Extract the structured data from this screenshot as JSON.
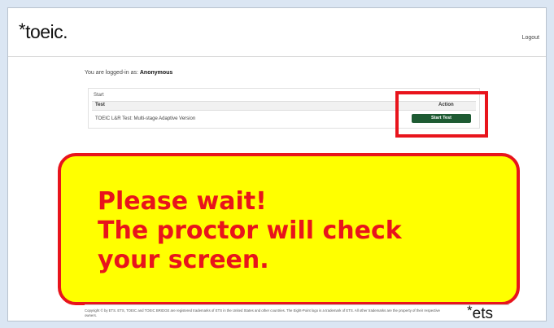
{
  "header": {
    "logo_star": "*",
    "logo_text": "toeic",
    "logo_dot": ".",
    "logout_label": "Logout"
  },
  "session": {
    "logged_in_prefix": "You are logged-in as:",
    "user_name": "Anonymous"
  },
  "tests_panel": {
    "title": "Start",
    "columns": [
      "Test",
      "Action"
    ],
    "rows": [
      {
        "test": "TOEIC L&R Test: Multi-stage Adaptive Version",
        "action_label": "Start Test"
      }
    ]
  },
  "notice": {
    "lines": [
      "Please wait!",
      "The proctor will check",
      "your screen."
    ]
  },
  "footer": {
    "copyright": "Copyright © by ETS. ETS, TOEIC and TOEIC BRIDGE are registered trademarks of ETS in the United States and other countries. The Eight-Point logo is a trademark of ETS. All other trademarks are the property of their respective owners.",
    "ets_star": "*",
    "ets_text": "ets"
  },
  "colors": {
    "accent_red": "#e8141c",
    "notice_yellow": "#ffff00",
    "button_green": "#1e5b33",
    "page_background": "#dbe6f3"
  }
}
